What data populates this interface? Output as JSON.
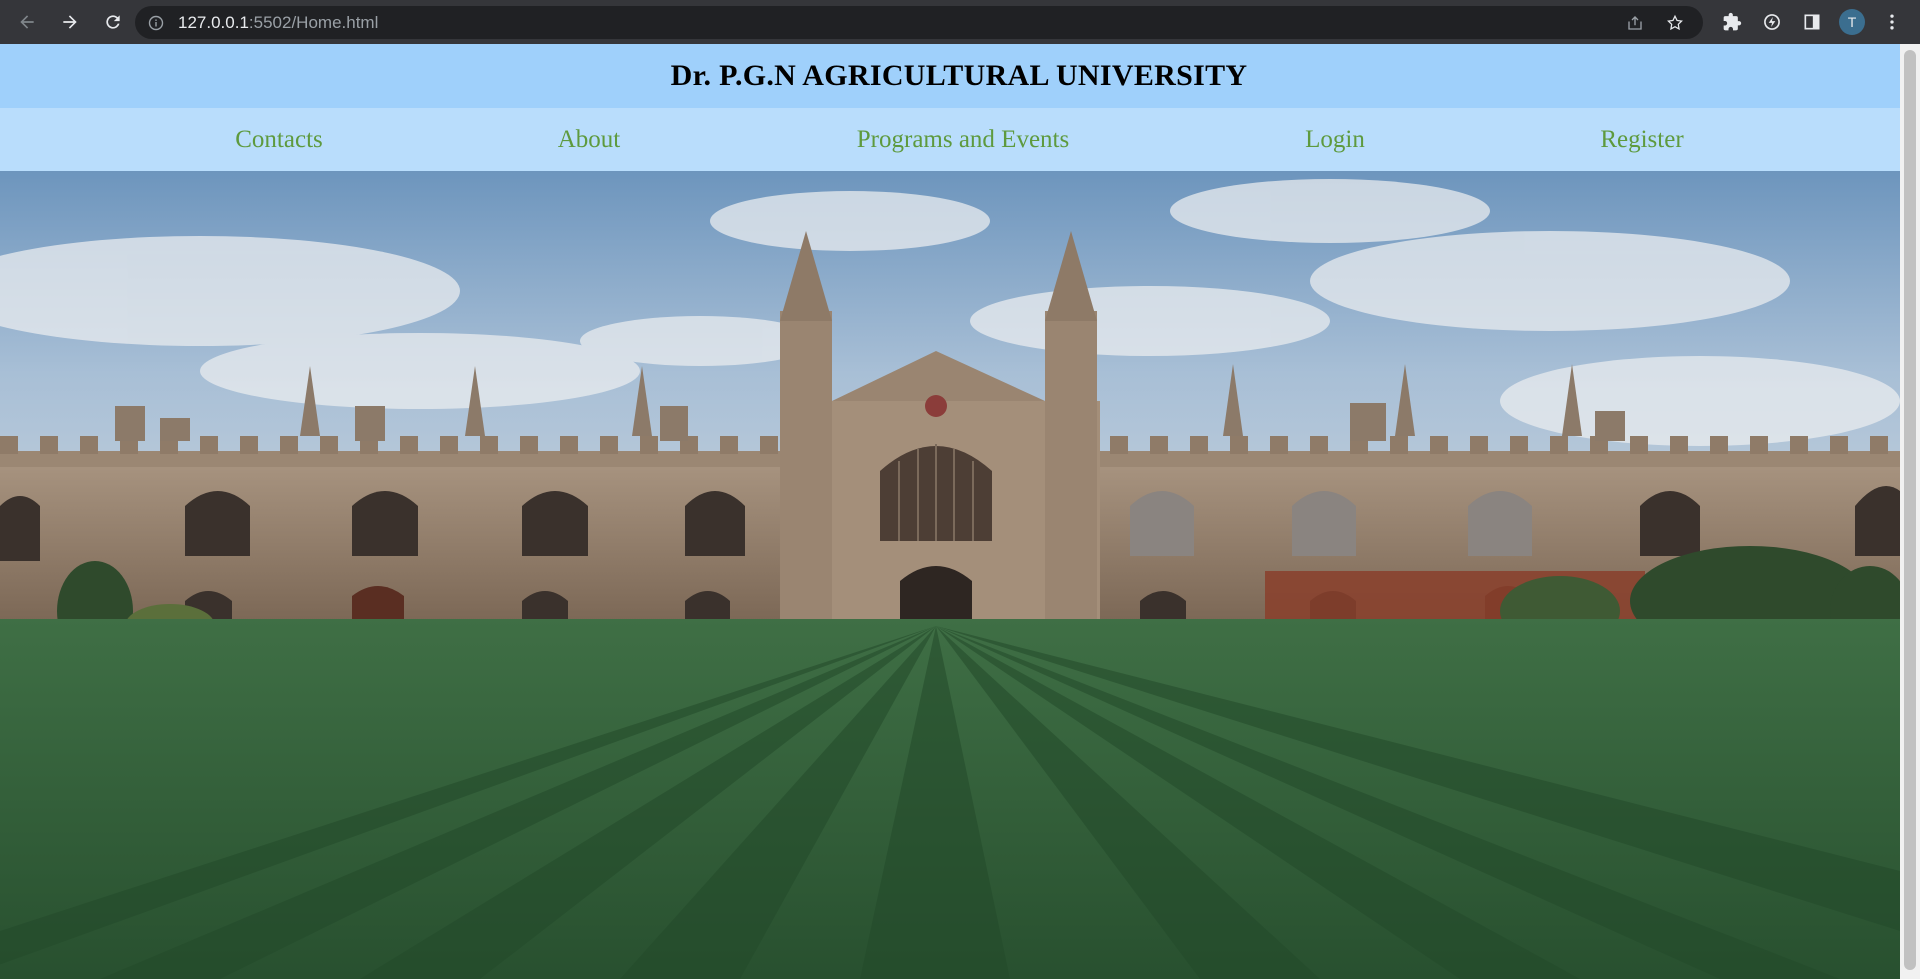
{
  "browser": {
    "url_host": "127.0.0.1",
    "url_path": ":5502/Home.html",
    "profile_initial": "T"
  },
  "site": {
    "title": "Dr. P.G.N AGRICULTURAL UNIVERSITY",
    "header_color": "#9fd0fb",
    "nav_color": "#b9ddfc",
    "link_color": "#5e9a3e",
    "nav": [
      {
        "label": "Contacts"
      },
      {
        "label": "About"
      },
      {
        "label": "Programs and Events"
      },
      {
        "label": "Login"
      },
      {
        "label": "Register"
      }
    ]
  },
  "hero": {
    "image": "university-building-photo"
  }
}
